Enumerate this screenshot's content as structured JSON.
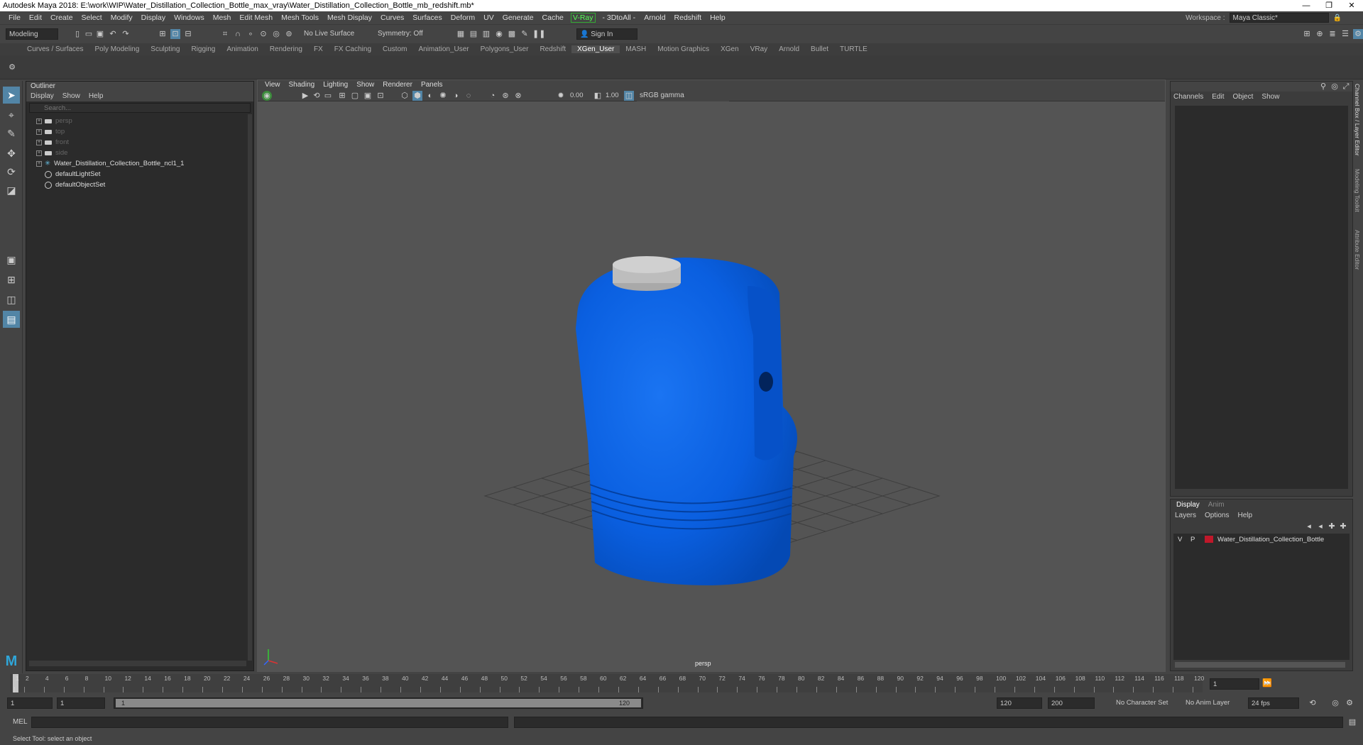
{
  "app": {
    "title": "Autodesk Maya 2018: E:\\work\\WIP\\Water_Distillation_Collection_Bottle_max_vray\\Water_Distillation_Collection_Bottle_mb_redshift.mb*",
    "window_buttons": [
      "—",
      "❐",
      "✕"
    ]
  },
  "menubar": {
    "items": [
      "File",
      "Edit",
      "Create",
      "Select",
      "Modify",
      "Display",
      "Windows",
      "Mesh",
      "Edit Mesh",
      "Mesh Tools",
      "Mesh Display",
      "Curves",
      "Surfaces",
      "Deform",
      "UV",
      "Generate",
      "Cache"
    ],
    "vray": "V-Ray",
    "items2": [
      "- 3DtoAll -",
      "Arnold",
      "Redshift",
      "Help"
    ],
    "workspace_label": "Workspace :",
    "workspace_value": "Maya Classic*"
  },
  "statusline": {
    "mode": "Modeling",
    "live_surface": "No Live Surface",
    "symmetry": "Symmetry: Off",
    "sign_in": "Sign In"
  },
  "shelf": {
    "tabs": [
      "Curves / Surfaces",
      "Poly Modeling",
      "Sculpting",
      "Rigging",
      "Animation",
      "Rendering",
      "FX",
      "FX Caching",
      "Custom",
      "Animation_User",
      "Polygons_User",
      "Redshift",
      "XGen_User",
      "MASH",
      "Motion Graphics",
      "XGen",
      "VRay",
      "Arnold",
      "Bullet",
      "TURTLE"
    ],
    "active": "XGen_User"
  },
  "outliner": {
    "title": "Outliner",
    "menu": [
      "Display",
      "Show",
      "Help"
    ],
    "search_placeholder": "Search...",
    "items": [
      {
        "label": "persp",
        "dim": true,
        "type": "camera"
      },
      {
        "label": "top",
        "dim": true,
        "type": "camera"
      },
      {
        "label": "front",
        "dim": true,
        "type": "camera"
      },
      {
        "label": "side",
        "dim": true,
        "type": "camera"
      },
      {
        "label": "Water_Distillation_Collection_Bottle_ncl1_1",
        "dim": false,
        "type": "group"
      },
      {
        "label": "defaultLightSet",
        "dim": false,
        "type": "set"
      },
      {
        "label": "defaultObjectSet",
        "dim": false,
        "type": "set"
      }
    ]
  },
  "viewport": {
    "menu": [
      "View",
      "Shading",
      "Lighting",
      "Show",
      "Renderer",
      "Panels"
    ],
    "exposure": "0.00",
    "gamma": "1.00",
    "color_space": "sRGB gamma",
    "camera_label": "persp",
    "object_color": "#0a5fe0",
    "cap_color": "#c9c9c9"
  },
  "channelbox": {
    "menu": [
      "Channels",
      "Edit",
      "Object",
      "Show"
    ]
  },
  "layers": {
    "tabs": [
      "Display",
      "Anim"
    ],
    "menu": [
      "Layers",
      "Options",
      "Help"
    ],
    "rows": [
      {
        "v": "V",
        "p": "P",
        "name": "Water_Distillation_Collection_Bottle",
        "color": "#c0182a"
      }
    ]
  },
  "sidetabs": [
    "Channel Box / Layer Editor",
    "Modeling Toolkit",
    "Attribute Editor"
  ],
  "timeline": {
    "ticks": [
      "1",
      "2",
      "4",
      "6",
      "8",
      "10",
      "12",
      "14",
      "16",
      "18",
      "20",
      "22",
      "24",
      "26",
      "28",
      "30",
      "32",
      "34",
      "36",
      "38",
      "40",
      "42",
      "44",
      "46",
      "48",
      "50",
      "52",
      "54",
      "56",
      "58",
      "60",
      "62",
      "64",
      "66",
      "68",
      "70",
      "72",
      "74",
      "76",
      "78",
      "80",
      "82",
      "84",
      "86",
      "88",
      "90",
      "92",
      "94",
      "96",
      "98",
      "100",
      "102",
      "104",
      "106",
      "108",
      "110",
      "112",
      "114",
      "116",
      "118",
      "120"
    ],
    "current_frame": "1"
  },
  "range": {
    "start": "1",
    "anim_start": "1",
    "slider_start": "1",
    "slider_end": "120",
    "end": "120",
    "anim_end": "200",
    "character_set": "No Character Set",
    "anim_layer": "No Anim Layer",
    "fps": "24 fps"
  },
  "cmdline": {
    "label": "MEL"
  },
  "helpline": {
    "text": "Select Tool: select an object"
  }
}
